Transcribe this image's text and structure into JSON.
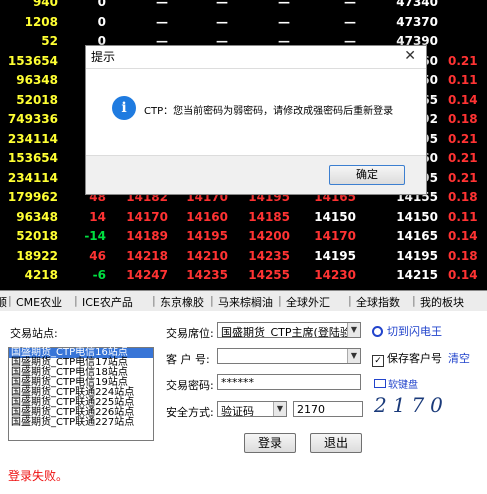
{
  "quote_rows": [
    {
      "c1": "940",
      "c2": "0",
      "c3": "—",
      "c4": "—",
      "c5": "—",
      "c6": "—",
      "c7": "47340",
      "c8": "",
      "c2c": "white",
      "c3c": "white",
      "c4c": "white",
      "c5c": "white",
      "c6c": "white",
      "c8c": "red"
    },
    {
      "c1": "1208",
      "c2": "0",
      "c3": "—",
      "c4": "—",
      "c5": "—",
      "c6": "—",
      "c7": "47370",
      "c8": "",
      "c2c": "white",
      "c3c": "white",
      "c4c": "white",
      "c5c": "white",
      "c6c": "white",
      "c8c": "red"
    },
    {
      "c1": "52",
      "c2": "0",
      "c3": "—",
      "c4": "—",
      "c5": "—",
      "c6": "—",
      "c7": "47390",
      "c8": "",
      "c2c": "white",
      "c3c": "white",
      "c4c": "white",
      "c5c": "white",
      "c6c": "white",
      "c8c": "red"
    },
    {
      "c1": "153654",
      "c2": "",
      "c3": "",
      "c4": "",
      "c5": "",
      "c6": "",
      "c7": "160",
      "c8": "0.21",
      "c2c": "red",
      "c3c": "red",
      "c4c": "red",
      "c5c": "red",
      "c6c": "red",
      "c8c": "red"
    },
    {
      "c1": "96348",
      "c2": "",
      "c3": "",
      "c4": "",
      "c5": "",
      "c6": "",
      "c7": "150",
      "c8": "0.11",
      "c2c": "red",
      "c3c": "red",
      "c4c": "red",
      "c5c": "red",
      "c6c": "red",
      "c8c": "red"
    },
    {
      "c1": "52018",
      "c2": "",
      "c3": "",
      "c4": "",
      "c5": "",
      "c6": "",
      "c7": "165",
      "c8": "0.14",
      "c2c": "green",
      "c3c": "red",
      "c4c": "red",
      "c5c": "red",
      "c6c": "red",
      "c8c": "red"
    },
    {
      "c1": "749336",
      "c2": "",
      "c3": "",
      "c4": "",
      "c5": "",
      "c6": "",
      "c7": "192",
      "c8": "0.18",
      "c2c": "red",
      "c3c": "red",
      "c4c": "red",
      "c5c": "red",
      "c6c": "red",
      "c8c": "red"
    },
    {
      "c1": "234114",
      "c2": "",
      "c3": "",
      "c4": "",
      "c5": "",
      "c6": "",
      "c7": "195",
      "c8": "0.21",
      "c2c": "red",
      "c3c": "red",
      "c4c": "red",
      "c5c": "red",
      "c6c": "red",
      "c8c": "red"
    },
    {
      "c1": "153654",
      "c2": "",
      "c3": "",
      "c4": "",
      "c5": "",
      "c6": "",
      "c7": "160",
      "c8": "0.21",
      "c2c": "red",
      "c3c": "red",
      "c4c": "red",
      "c5c": "red",
      "c6c": "red",
      "c8c": "red"
    },
    {
      "c1": "234114",
      "c2": "",
      "c3": "",
      "c4": "",
      "c5": "",
      "c6": "",
      "c7": "195",
      "c8": "0.21",
      "c2c": "red",
      "c3c": "red",
      "c4c": "red",
      "c5c": "red",
      "c6c": "red",
      "c8c": "red"
    },
    {
      "c1": "179962",
      "c2": "48",
      "c3": "14182",
      "c4": "14170",
      "c5": "14195",
      "c6": "14165",
      "c7": "14155",
      "c8": "0.18",
      "c2c": "red",
      "c3c": "red",
      "c4c": "red",
      "c5c": "red",
      "c6c": "red",
      "c8c": "red"
    },
    {
      "c1": "96348",
      "c2": "14",
      "c3": "14170",
      "c4": "14160",
      "c5": "14185",
      "c6": "14150",
      "c7": "14150",
      "c8": "0.11",
      "c2c": "red",
      "c3c": "red",
      "c4c": "red",
      "c5c": "red",
      "c6c": "white",
      "c8c": "red"
    },
    {
      "c1": "52018",
      "c2": "-14",
      "c3": "14189",
      "c4": "14195",
      "c5": "14200",
      "c6": "14170",
      "c7": "14165",
      "c8": "0.14",
      "c2c": "green",
      "c3c": "red",
      "c4c": "red",
      "c5c": "red",
      "c6c": "red",
      "c8c": "red"
    },
    {
      "c1": "18922",
      "c2": "46",
      "c3": "14218",
      "c4": "14210",
      "c5": "14235",
      "c6": "14195",
      "c7": "14195",
      "c8": "0.18",
      "c2c": "red",
      "c3c": "red",
      "c4c": "red",
      "c5c": "red",
      "c6c": "white",
      "c8c": "red"
    },
    {
      "c1": "4218",
      "c2": "-6",
      "c3": "14247",
      "c4": "14235",
      "c5": "14255",
      "c6": "14230",
      "c7": "14215",
      "c8": "0.14",
      "c2c": "green",
      "c3c": "red",
      "c4c": "red",
      "c5c": "red",
      "c6c": "red",
      "c8c": "red"
    }
  ],
  "tabs": [
    "顺",
    "CME农业",
    "ICE农产品",
    "东京橡胶",
    "马来棕榈油",
    "全球外汇",
    "全球指数",
    "我的板块"
  ],
  "dialog": {
    "title": "提示",
    "close": "✕",
    "info_icon": "i",
    "message": "CTP：您当前密码为弱密码，请修改成强密码后重新登录",
    "ok_label": "确定"
  },
  "login": {
    "station_label": "交易站点:",
    "stations": [
      "国盛期货_CTP电信16站点",
      "国盛期货_CTP电信17站点",
      "国盛期货_CTP电信18站点",
      "国盛期货_CTP电信19站点",
      "国盛期货_CTP联通224站点",
      "国盛期货_CTP联通225站点",
      "国盛期货_CTP联通226站点",
      "国盛期货_CTP联通227站点"
    ],
    "seat_label": "交易席位:",
    "seat_value": "国盛期货_CTP主席(登陆验",
    "switch_label": "切到闪电王",
    "account_label": "客 户 号:",
    "account_value": "",
    "save_label": "保存客户号",
    "clear_label": "清空",
    "password_label": "交易密码:",
    "password_value": "******",
    "softkb_label": "软键盘",
    "security_label": "安全方式:",
    "security_value": "验证码",
    "captcha_value": "2170",
    "captcha_image_text": "2170",
    "login_button": "登录",
    "exit_button": "退出",
    "status": "登录失败。"
  }
}
